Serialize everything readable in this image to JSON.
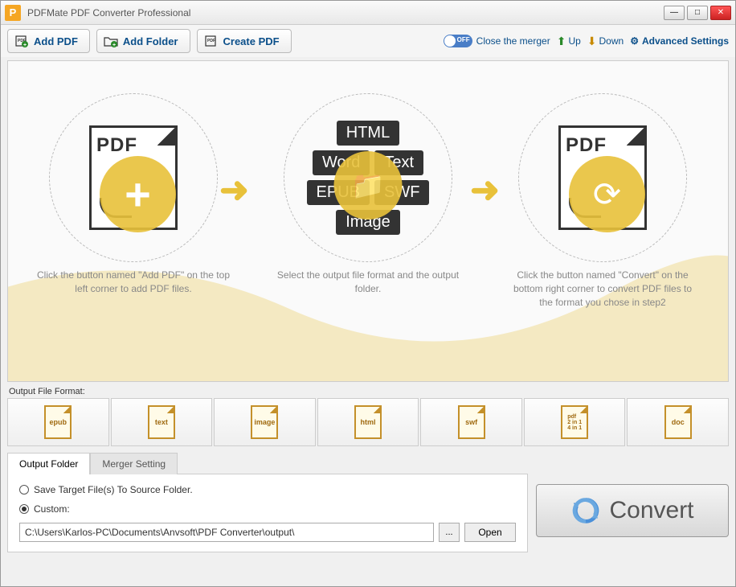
{
  "app": {
    "title": "PDFMate PDF Converter Professional",
    "logo_letter": "P"
  },
  "toolbar": {
    "add_pdf": "Add PDF",
    "add_folder": "Add Folder",
    "create_pdf": "Create PDF",
    "close_merger": "Close the merger",
    "toggle_state": "OFF",
    "up": "Up",
    "down": "Down",
    "advanced": "Advanced Settings"
  },
  "steps": {
    "s1": {
      "label": "PDF",
      "caption": "Click the button named \"Add PDF\" on the top left corner to add PDF files."
    },
    "s2": {
      "caption": "Select the output file format and the output folder.",
      "formats": {
        "html": "HTML",
        "word": "Word",
        "text": "Text",
        "epub": "EPUB",
        "swf": "SWF",
        "image": "Image"
      }
    },
    "s3": {
      "label": "PDF",
      "caption": "Click the button named \"Convert\" on the bottom right corner to convert PDF files to the format you chose in step2"
    }
  },
  "output_format_label": "Output File Format:",
  "formats": [
    "epub",
    "text",
    "image",
    "html",
    "swf",
    "pdf\n2 in 1\n4 in 1",
    "doc"
  ],
  "tabs": {
    "output_folder": "Output Folder",
    "merger_setting": "Merger Setting"
  },
  "output_panel": {
    "save_source": "Save Target File(s) To Source Folder.",
    "custom": "Custom:",
    "path": "C:\\Users\\Karlos-PC\\Documents\\Anvsoft\\PDF Converter\\output\\",
    "browse": "...",
    "open": "Open"
  },
  "convert": "Convert"
}
